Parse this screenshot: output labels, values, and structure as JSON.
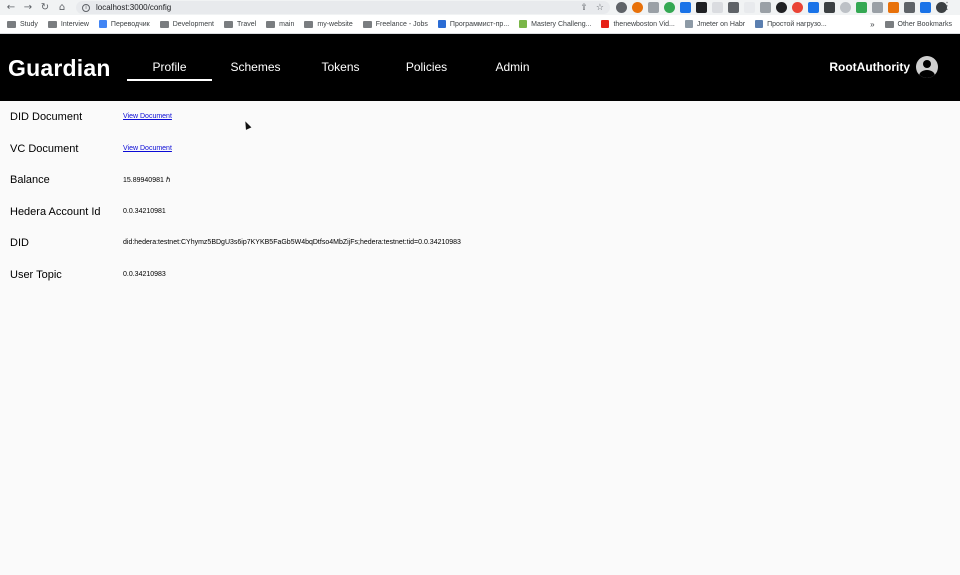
{
  "browser": {
    "url": "localhost:3000/config",
    "bookmarks": [
      {
        "label": "Study",
        "type": "folder"
      },
      {
        "label": "Interview",
        "type": "folder"
      },
      {
        "label": "Переводчик",
        "type": "site",
        "color": "#4285f4"
      },
      {
        "label": "Development",
        "type": "folder"
      },
      {
        "label": "Travel",
        "type": "folder"
      },
      {
        "label": "main",
        "type": "folder"
      },
      {
        "label": "my-website",
        "type": "folder"
      },
      {
        "label": "Freelance - Jobs",
        "type": "folder"
      },
      {
        "label": "Программист-пр...",
        "type": "site",
        "color": "#2b6cd4"
      },
      {
        "label": "Mastery Challeng...",
        "type": "site",
        "color": "#7ab648"
      },
      {
        "label": "thenewboston Vid...",
        "type": "site",
        "color": "#e62117"
      },
      {
        "label": "Jmeter on Habr",
        "type": "site",
        "color": "#8d9aa6"
      },
      {
        "label": "Простой нагрузо...",
        "type": "site",
        "color": "#5b7fb0"
      }
    ],
    "other_bookmarks": "Other Bookmarks"
  },
  "app": {
    "logo": "Guardian",
    "nav": [
      {
        "label": "Profile",
        "active": true
      },
      {
        "label": "Schemes",
        "active": false
      },
      {
        "label": "Tokens",
        "active": false
      },
      {
        "label": "Policies",
        "active": false
      },
      {
        "label": "Admin",
        "active": false
      }
    ],
    "user": "RootAuthority"
  },
  "profile": [
    {
      "label": "DID Document",
      "value": "View Document",
      "is_link": true
    },
    {
      "label": "VC Document",
      "value": "View Document",
      "is_link": true
    },
    {
      "label": "Balance",
      "value": "15.89940981 ℏ",
      "is_link": false
    },
    {
      "label": "Hedera Account Id",
      "value": "0.0.34210981",
      "is_link": false
    },
    {
      "label": "DID",
      "value": "did:hedera:testnet:CYhymz5BDgU3s6ip7KYKB5FaGb5W4bqDtfso4MbZijFs;hedera:testnet:tid=0.0.34210983",
      "is_link": false
    },
    {
      "label": "User Topic",
      "value": "0.0.34210983",
      "is_link": false
    }
  ]
}
